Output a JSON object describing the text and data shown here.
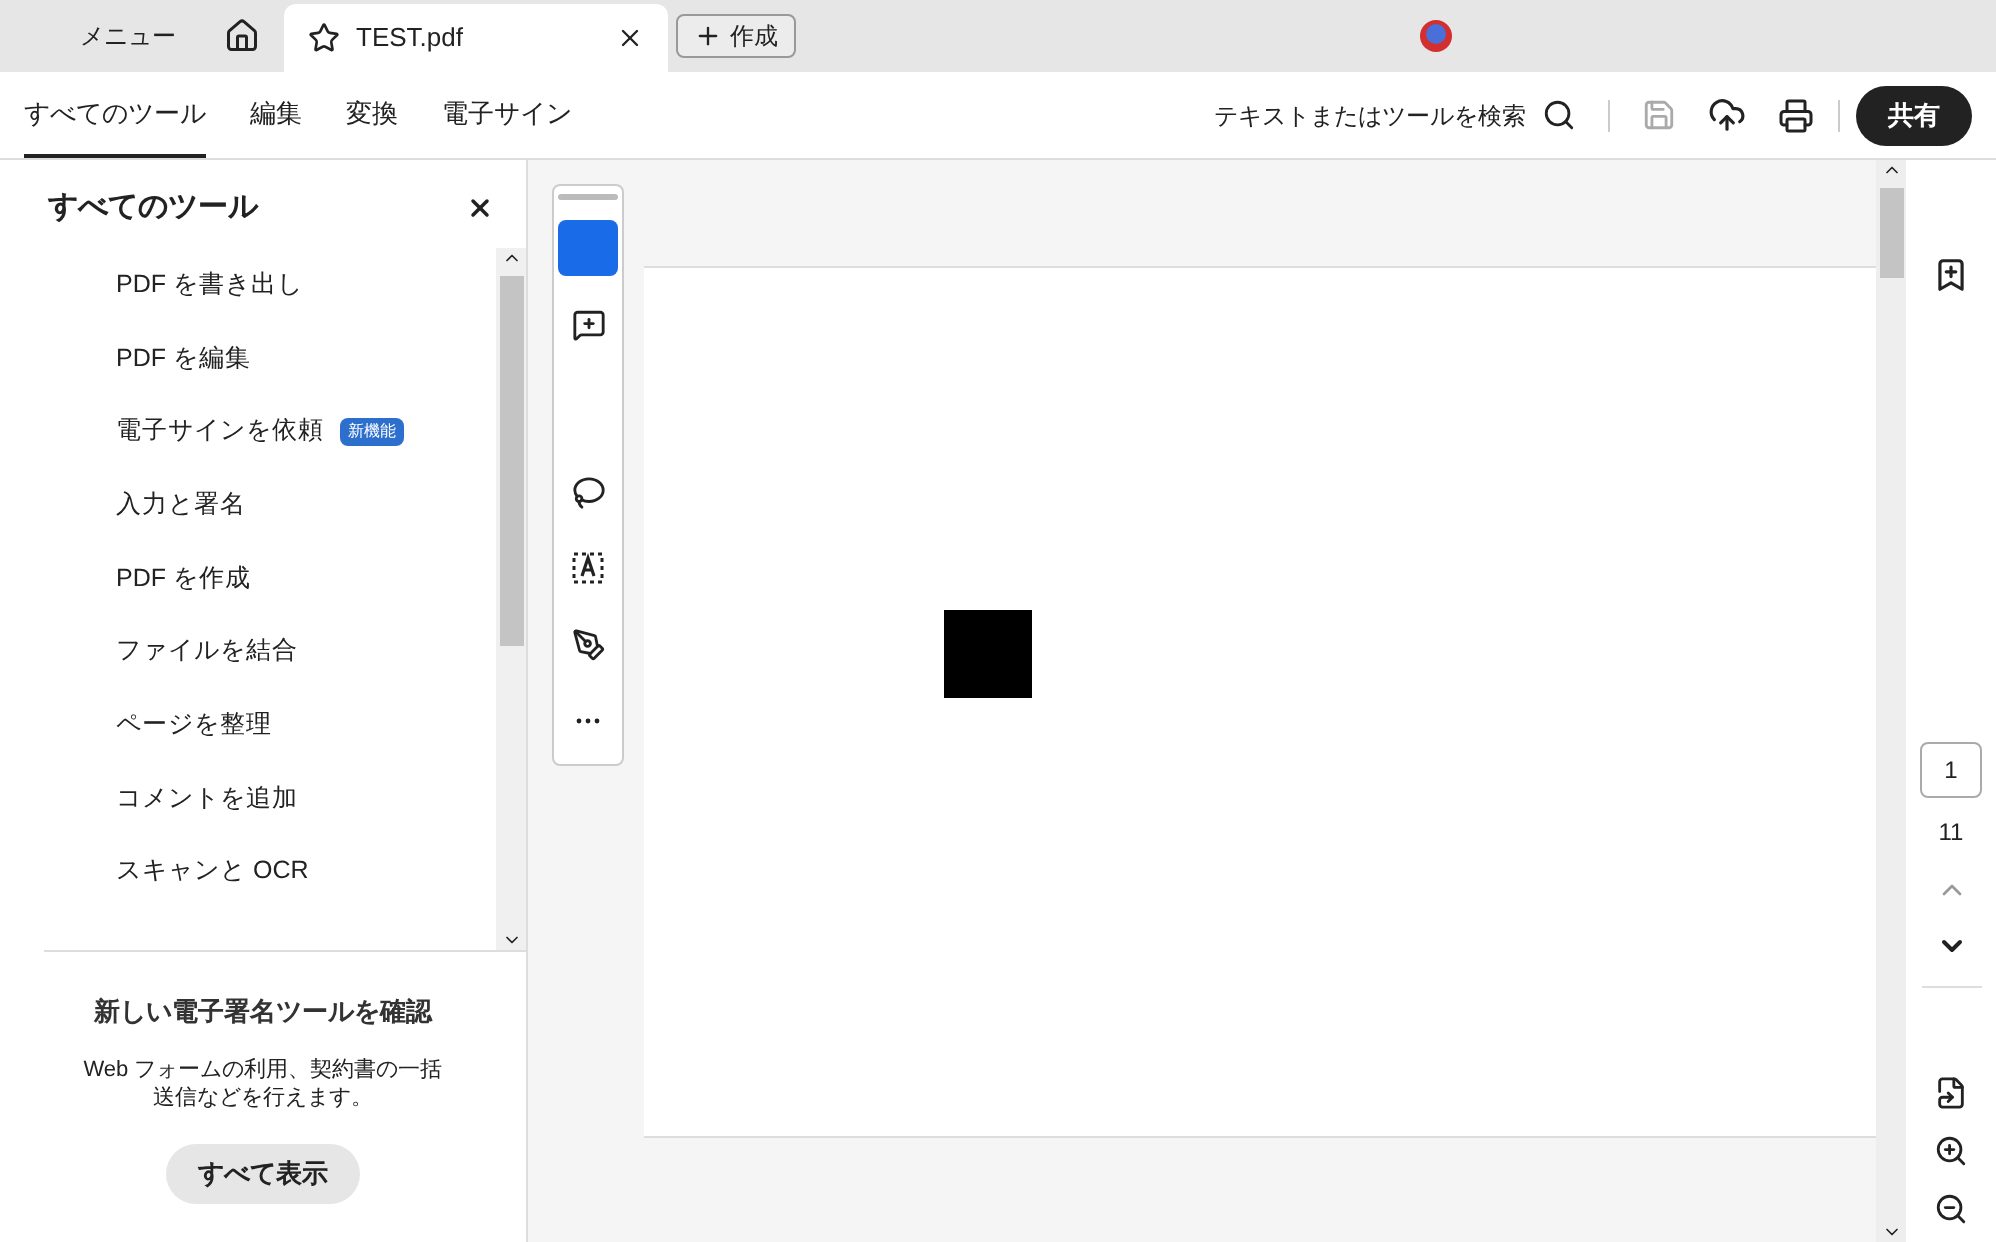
{
  "tab_bar": {
    "menu": "メニュー",
    "tabs": [
      {
        "title": "TEST.pdf",
        "selected": true
      }
    ],
    "create_button": "作成"
  },
  "toolbar": {
    "tabs": [
      {
        "label": "すべてのツール",
        "selected": true
      },
      {
        "label": "編集",
        "selected": false
      },
      {
        "label": "変換",
        "selected": false
      },
      {
        "label": "電子サイン",
        "selected": false
      }
    ],
    "search": "テキストまたはツールを検索",
    "share_button": "共有"
  },
  "sidebar": {
    "title": "すべてのツール",
    "items": [
      {
        "label": "PDF を書き出し"
      },
      {
        "label": "PDF を編集"
      },
      {
        "label": "電子サインを依頼",
        "badge": "新機能"
      },
      {
        "label": "入力と署名"
      },
      {
        "label": "PDF を作成"
      },
      {
        "label": "ファイルを結合"
      },
      {
        "label": "ページを整理"
      },
      {
        "label": "コメントを追加"
      },
      {
        "label": "スキャンと OCR"
      }
    ],
    "promo": {
      "title": "新しい電子署名ツールを確認",
      "text": "Web フォームの利用、契約書の一括送信などを行えます。",
      "button": "すべて表示"
    }
  },
  "tools": [
    {
      "kind": "select",
      "selected": true
    },
    {
      "kind": "comment",
      "selected": false
    },
    {
      "kind": "spacer"
    },
    {
      "kind": "lasso",
      "selected": false
    },
    {
      "kind": "text",
      "selected": false
    },
    {
      "kind": "draw",
      "selected": false
    },
    {
      "kind": "more",
      "selected": false
    }
  ],
  "page_nav": {
    "current": "1",
    "total": "11"
  }
}
